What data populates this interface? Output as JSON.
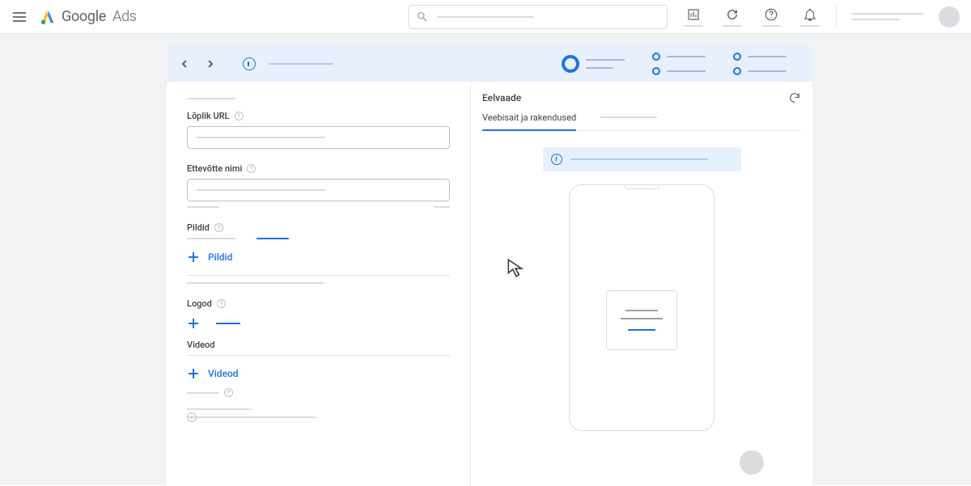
{
  "header": {
    "brand_google": "Google",
    "brand_ads": "Ads"
  },
  "left": {
    "final_url_label": "Lõplik URL",
    "business_name_label": "Ettevõtte nimi",
    "images_label": "Pildid",
    "images_add": "Pildid",
    "logos_label": "Logod",
    "videos_label": "Videod",
    "videos_add": "Videod"
  },
  "right": {
    "preview_title": "Eelvaade",
    "tab_website": "Veebisait ja rakendused"
  }
}
